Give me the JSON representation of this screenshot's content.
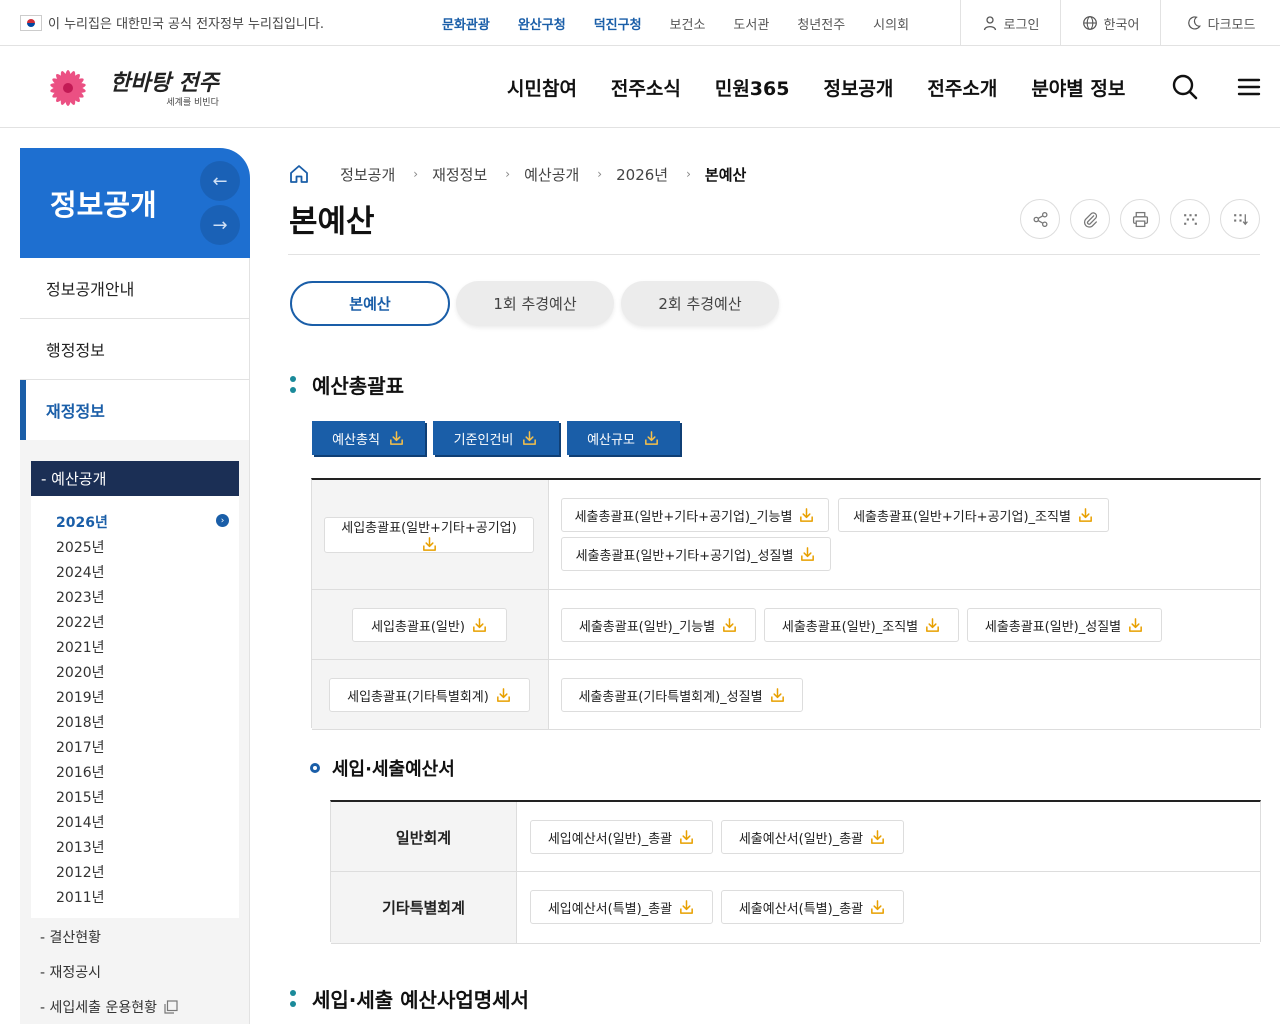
{
  "topbar": {
    "gov_notice": "이 누리집은 대한민국 공식 전자정부 누리집입니다.",
    "quick_links": [
      "문화관광",
      "완산구청",
      "덕진구청",
      "보건소",
      "도서관",
      "청년전주",
      "시의회"
    ],
    "login": "로그인",
    "language": "한국어",
    "dark_mode": "다크모드"
  },
  "header": {
    "logo_main": "한바탕 전주",
    "logo_sub": "세계를 비빈다",
    "gnb": [
      "시민참여",
      "전주소식",
      "민원365",
      "정보공개",
      "전주소개",
      "분야별 정보"
    ]
  },
  "sidebar": {
    "title": "정보공개",
    "menu": [
      "정보공개안내",
      "행정정보",
      "재정정보"
    ],
    "sub_head": "- 예산공개",
    "years": [
      "2026년",
      "2025년",
      "2024년",
      "2023년",
      "2022년",
      "2021년",
      "2020년",
      "2019년",
      "2018년",
      "2017년",
      "2016년",
      "2015년",
      "2014년",
      "2013년",
      "2012년",
      "2011년"
    ],
    "sub_links": [
      "- 결산현황",
      "- 재정공시",
      "- 세입세출 운용현황"
    ]
  },
  "breadcrumb": [
    "정보공개",
    "재정정보",
    "예산공개",
    "2026년",
    "본예산"
  ],
  "page_title": "본예산",
  "tabs": [
    "본예산",
    "1회 추경예산",
    "2회 추경예산"
  ],
  "section1": {
    "title": "예산총괄표",
    "buttons": [
      "예산총칙",
      "기준인건비",
      "예산규모"
    ],
    "rows": [
      {
        "left": "세입총괄표(일반+기타+공기업)",
        "right": [
          "세출총괄표(일반+기타+공기업)_기능별",
          "세출총괄표(일반+기타+공기업)_조직별",
          "세출총괄표(일반+기타+공기업)_성질별"
        ]
      },
      {
        "left": "세입총괄표(일반)",
        "right": [
          "세출총괄표(일반)_기능별",
          "세출총괄표(일반)_조직별",
          "세출총괄표(일반)_성질별"
        ]
      },
      {
        "left": "세입총괄표(기타특별회계)",
        "right": [
          "세출총괄표(기타특별회계)_성질별"
        ]
      }
    ]
  },
  "section2": {
    "title": "세입·세출예산서",
    "rows": [
      {
        "label": "일반회계",
        "files": [
          "세입예산서(일반)_총괄",
          "세출예산서(일반)_총괄"
        ]
      },
      {
        "label": "기타특별회계",
        "files": [
          "세입예산서(특별)_총괄",
          "세출예산서(특별)_총괄"
        ]
      }
    ]
  },
  "section3": {
    "title": "세입·세출 예산사업명세서"
  },
  "colors": {
    "primary": "#1a5ea8",
    "sidebar_title_bg": "#1e6fd0",
    "sub_head_bg": "#1b2f55",
    "accent_dot": "#1a8a9a",
    "download_icon": "#e8a000"
  }
}
